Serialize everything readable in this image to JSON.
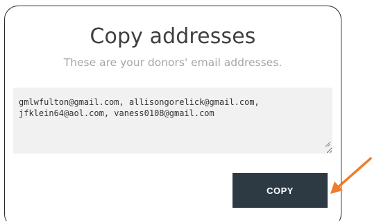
{
  "dialog": {
    "title": "Copy addresses",
    "subtitle": "These are your donors' email addresses.",
    "addresses_text": "gmlwfulton@gmail.com, allisongorelick@gmail.com,\njfklein64@aol.com, vaness0108@gmail.com",
    "copy_label": "COPY"
  },
  "colors": {
    "button_bg": "#2d3a44",
    "arrow": "#ef7d2d",
    "textarea_bg": "#f1f1f1"
  },
  "icons": {
    "annotation": "arrow-icon",
    "resize": "resize-grip-icon"
  }
}
